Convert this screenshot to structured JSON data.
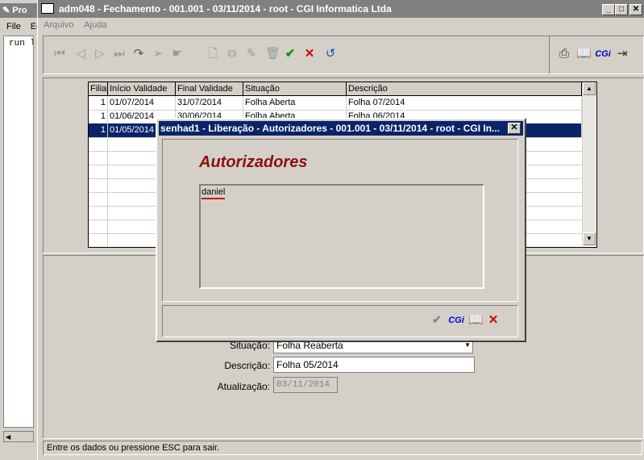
{
  "bg_window": {
    "title": "Pro",
    "menu": [
      "File",
      "Ed"
    ],
    "code": "run l"
  },
  "main_window": {
    "title": "adm048 - Fechamento - 001.001 - 03/11/2014 - root - CGI Informatica Ltda",
    "menu": [
      "Arquivo",
      "Ajuda"
    ],
    "cgi_label": "CGi"
  },
  "grid": {
    "columns": [
      "Filial",
      "Início Validade",
      "Final Validade",
      "Situação",
      "Descrição"
    ],
    "rows": [
      {
        "filial": "1",
        "inicio": "01/07/2014",
        "final": "31/07/2014",
        "situacao": "Folha Aberta",
        "descricao": "Folha 07/2014"
      },
      {
        "filial": "1",
        "inicio": "01/06/2014",
        "final": "30/06/2014",
        "situacao": "Folha Aberta",
        "descricao": "Folha 06/2014"
      },
      {
        "filial": "1",
        "inicio": "01/05/2014",
        "final": "",
        "situacao": "",
        "descricao": ""
      }
    ]
  },
  "form": {
    "situacao_label": "Situação:",
    "situacao_value": "Folha Reaberta",
    "descricao_label": "Descrição:",
    "descricao_value": "Folha 05/2014",
    "atualizacao_label": "Atualização:",
    "atualizacao_value": "03/11/2014"
  },
  "status_bar": "Entre os dados ou pressione ESC para sair.",
  "dialog": {
    "title": "senhad1 - Liberação - Autorizadores - 001.001 - 03/11/2014 - root - CGI In...",
    "heading": "Autorizadores",
    "items": [
      "daniel"
    ],
    "cgi_label": "CGi"
  },
  "colors": {
    "selection": "#0a246a",
    "heading": "#8b1010",
    "cancel": "#d40000",
    "confirm": "#00a000",
    "cgi": "#0000cc"
  }
}
